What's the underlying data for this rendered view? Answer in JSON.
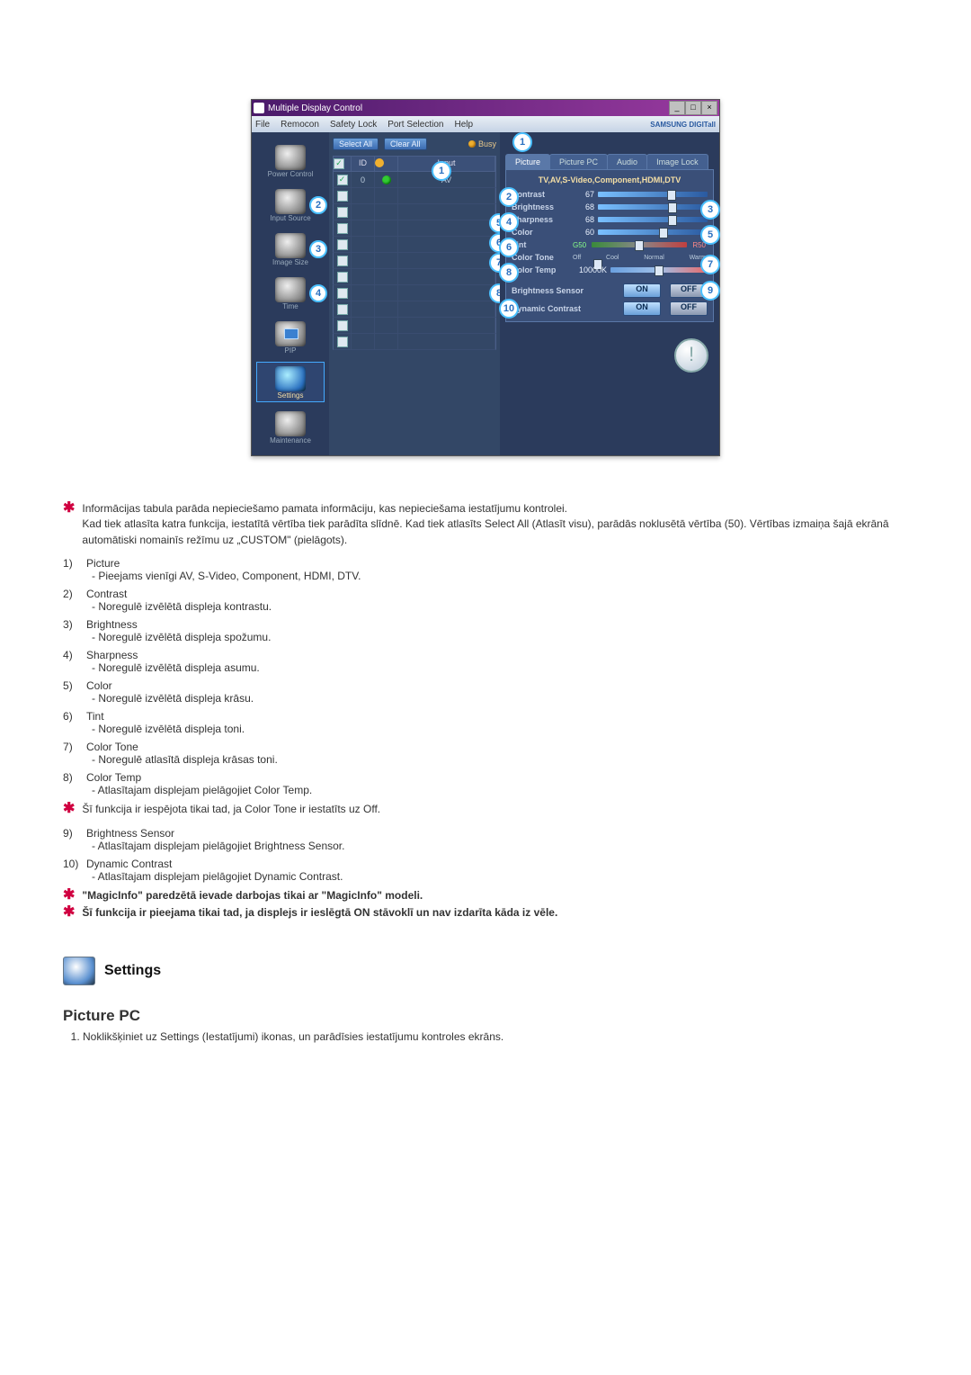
{
  "app": {
    "title": "Multiple Display Control",
    "brand": "SAMSUNG DIGITall",
    "menus": [
      "File",
      "Remocon",
      "Safety Lock",
      "Port Selection",
      "Help"
    ]
  },
  "sidebar": {
    "items": [
      {
        "label": "Power Control"
      },
      {
        "label": "Input Source",
        "callout": "2"
      },
      {
        "label": "Image Size",
        "callout": "3"
      },
      {
        "label": "Time",
        "callout": "4"
      },
      {
        "label": "PIP"
      },
      {
        "label": "Settings",
        "selected": true
      },
      {
        "label": "Maintenance"
      }
    ]
  },
  "mid": {
    "select_all": "Select All",
    "clear_all": "Clear All",
    "busy": "Busy",
    "head": {
      "chk": "☑",
      "id": "ID",
      "stat": "",
      "input_col": "Input"
    },
    "rows": [
      {
        "id": "0",
        "input": "AV",
        "checked": true,
        "status": true
      },
      {
        "id": "",
        "input": ""
      },
      {
        "id": "",
        "input": ""
      },
      {
        "id": "",
        "input": ""
      },
      {
        "id": "",
        "input": ""
      },
      {
        "id": "",
        "input": ""
      },
      {
        "id": "",
        "input": ""
      },
      {
        "id": "",
        "input": ""
      },
      {
        "id": "",
        "input": ""
      },
      {
        "id": "",
        "input": ""
      },
      {
        "id": "",
        "input": ""
      }
    ],
    "callouts": {
      "top": "1",
      "c5": "5",
      "c6": "6",
      "c7": "7",
      "c8": "8"
    }
  },
  "right": {
    "tabs": [
      "Picture",
      "Picture PC",
      "Audio",
      "Image Lock"
    ],
    "active_tab": 0,
    "panel_title": "TV,AV,S-Video,Component,HDMI,DTV",
    "sliders": {
      "contrast": {
        "label": "Contrast",
        "value": "67",
        "thumb": 67
      },
      "brightness": {
        "label": "Brightness",
        "value": "68",
        "thumb": 68
      },
      "sharpness": {
        "label": "Sharpness",
        "value": "68",
        "thumb": 68
      },
      "color": {
        "label": "Color",
        "value": "60",
        "thumb": 60
      }
    },
    "tint": {
      "label": "Tint",
      "g": "G50",
      "r": "R50",
      "thumb": 50
    },
    "color_tone": {
      "label": "Color Tone",
      "marks": [
        "Off",
        "Cool",
        "Normal",
        "Warm"
      ],
      "thumb": 20
    },
    "color_temp": {
      "label": "Color Temp",
      "value": "10000K",
      "thumb": 50
    },
    "brightness_sensor": {
      "label": "Brightness Sensor",
      "on": "ON",
      "off": "OFF"
    },
    "dynamic_contrast": {
      "label": "Dynamic Contrast",
      "on": "ON",
      "off": "OFF"
    },
    "callouts": {
      "tabs": "1",
      "c2": "2",
      "c3": "3",
      "c4": "4",
      "c5": "5",
      "c6": "6",
      "c7": "7",
      "c8": "8",
      "c9": "9",
      "c10": "10"
    }
  },
  "doc": {
    "intro1": "Informācijas tabula parāda nepieciešamo pamata informāciju, kas nepieciešama iestatījumu kontrolei.",
    "intro2": "Kad tiek atlasīta katra funkcija, iestatītā vērtība tiek parādīta slīdnē. Kad tiek atlasīts Select All (Atlasīt visu), parādās noklusētā vērtība (50). Vērtības izmaiņa šajā ekrānā automātiski nomainīs režīmu uz „CUSTOM\" (pielāgots).",
    "items": [
      {
        "t": "Picture",
        "d": "- Pieejams vienīgi AV, S-Video, Component, HDMI, DTV."
      },
      {
        "t": "Contrast",
        "d": "- Noregulē izvēlētā displeja kontrastu."
      },
      {
        "t": "Brightness",
        "d": "- Noregulē izvēlētā displeja spožumu."
      },
      {
        "t": "Sharpness",
        "d": "- Noregulē izvēlētā displeja asumu."
      },
      {
        "t": "Color",
        "d": "- Noregulē izvēlētā displeja krāsu."
      },
      {
        "t": "Tint",
        "d": "- Noregulē izvēlētā displeja toni."
      },
      {
        "t": "Color Tone",
        "d": "- Noregulē atlasītā displeja krāsas toni."
      },
      {
        "t": "Color Temp",
        "d": "- Atlasītajam displejam pielāgojiet Color Temp."
      }
    ],
    "mid_note": "Šī funkcija ir iespējota tikai tad, ja Color Tone ir iestatīts uz Off.",
    "items2": [
      {
        "n": "9",
        "t": "Brightness Sensor",
        "d": "- Atlasītajam displejam pielāgojiet Brightness Sensor."
      },
      {
        "n": "10",
        "t": "Dynamic Contrast",
        "d": "- Atlasītajam displejam pielāgojiet Dynamic Contrast."
      }
    ],
    "note_a": "\"MagicInfo\" paredzētā ievade darbojas tikai ar \"MagicInfo\" modeli.",
    "note_b": "Šī funkcija ir pieejama tikai tad, ja displejs ir ieslēgtā ON stāvoklī un nav izdarīta kāda iz vēle.",
    "section_title": "Settings",
    "sub_title": "Picture PC",
    "step1": "Noklikšķiniet uz Settings (Iestatījumi) ikonas, un parādīsies iestatījumu kontroles ekrāns."
  }
}
